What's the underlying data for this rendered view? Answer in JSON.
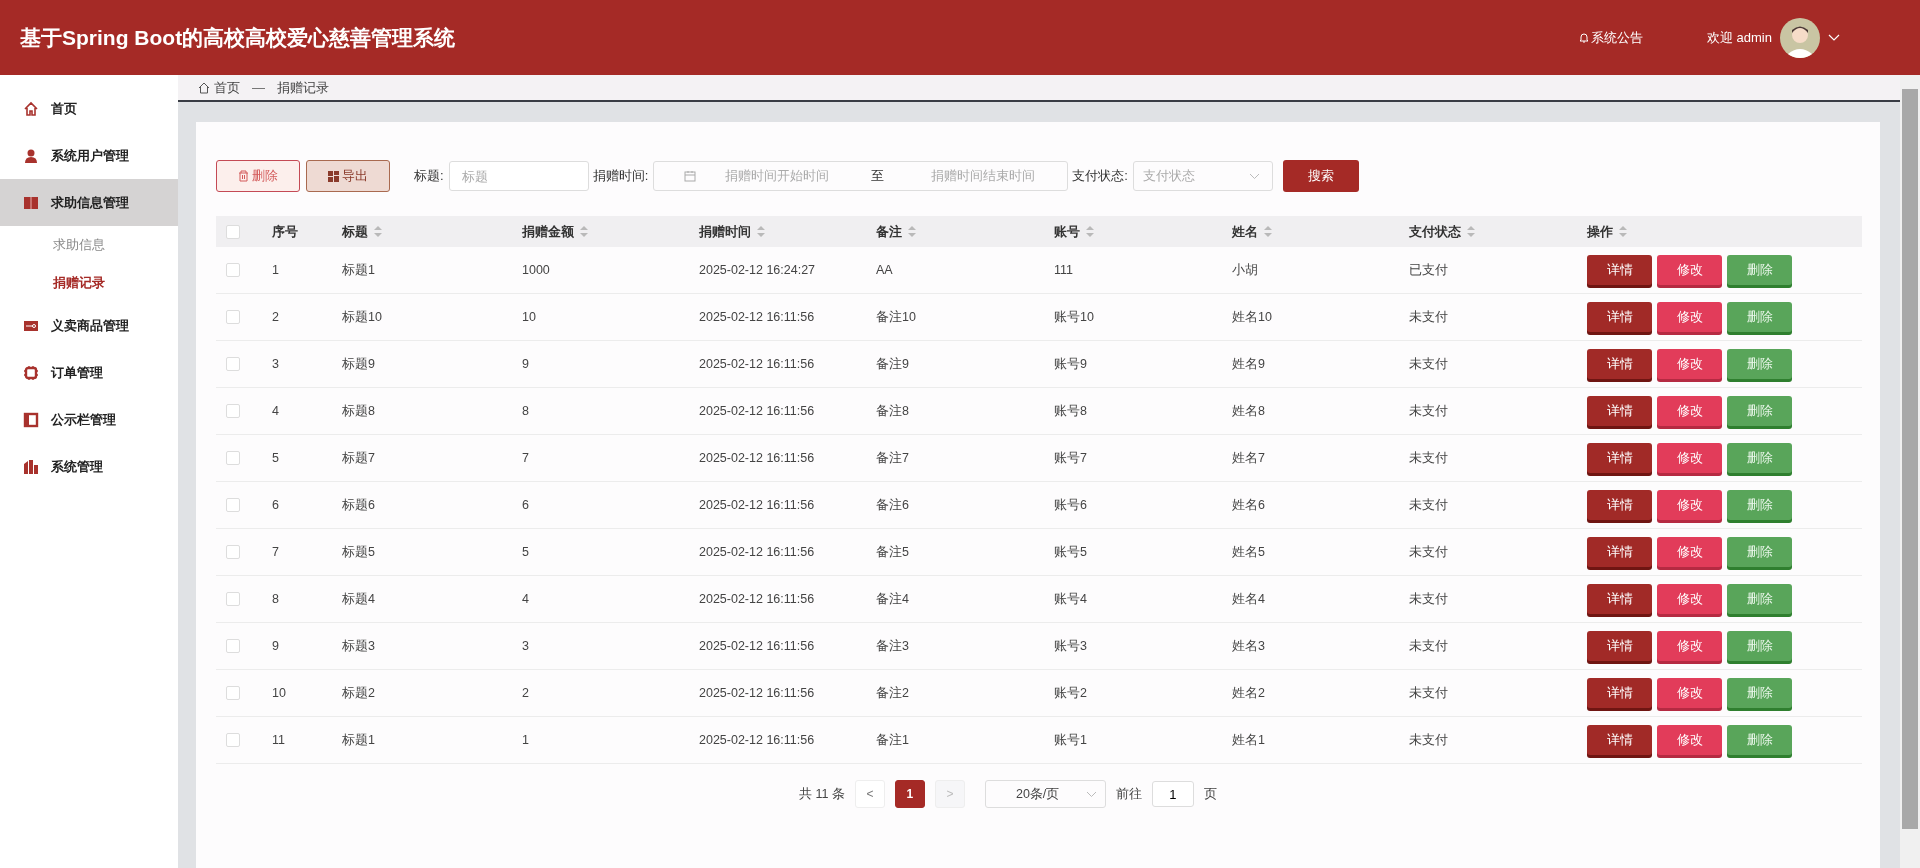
{
  "header": {
    "title": "基于Spring Boot的高校高校爱心慈善管理系统",
    "notice": "系统公告",
    "welcome": "欢迎 admin"
  },
  "sidebar": {
    "items": [
      {
        "label": "首页",
        "expanded": false
      },
      {
        "label": "系统用户管理",
        "expanded": false
      },
      {
        "label": "求助信息管理",
        "expanded": true,
        "children": [
          {
            "label": "求助信息",
            "selected": false
          },
          {
            "label": "捐赠记录",
            "selected": true
          }
        ]
      },
      {
        "label": "义卖商品管理",
        "expanded": false
      },
      {
        "label": "订单管理",
        "expanded": false
      },
      {
        "label": "公示栏管理",
        "expanded": false
      },
      {
        "label": "系统管理",
        "expanded": false
      }
    ]
  },
  "breadcrumb": {
    "items": [
      "首页",
      "捐赠记录"
    ],
    "separator": "—"
  },
  "toolbar": {
    "delete": "删除",
    "export": "导出",
    "title_label": "标题:",
    "title_placeholder": "标题",
    "time_label": "捐赠时间:",
    "start_placeholder": "捐赠时间开始时间",
    "range_sep": "至",
    "end_placeholder": "捐赠时间结束时间",
    "status_label": "支付状态:",
    "status_placeholder": "支付状态",
    "search": "搜索"
  },
  "table": {
    "header_checked": false,
    "columns": [
      "序号",
      "标题",
      "捐赠金额",
      "捐赠时间",
      "备注",
      "账号",
      "姓名",
      "支付状态",
      "操作"
    ],
    "rows": [
      {
        "checked": false,
        "cells": [
          "1",
          "标题1",
          "1000",
          "2025-02-12 16:24:27",
          "AA",
          "111",
          "小胡",
          "已支付"
        ],
        "actions": [
          "详情",
          "修改",
          "删除"
        ]
      },
      {
        "checked": false,
        "cells": [
          "2",
          "标题10",
          "10",
          "2025-02-12 16:11:56",
          "备注10",
          "账号10",
          "姓名10",
          "未支付"
        ],
        "actions": [
          "详情",
          "修改",
          "删除"
        ]
      },
      {
        "checked": false,
        "cells": [
          "3",
          "标题9",
          "9",
          "2025-02-12 16:11:56",
          "备注9",
          "账号9",
          "姓名9",
          "未支付"
        ],
        "actions": [
          "详情",
          "修改",
          "删除"
        ]
      },
      {
        "checked": false,
        "cells": [
          "4",
          "标题8",
          "8",
          "2025-02-12 16:11:56",
          "备注8",
          "账号8",
          "姓名8",
          "未支付"
        ],
        "actions": [
          "详情",
          "修改",
          "删除"
        ]
      },
      {
        "checked": false,
        "cells": [
          "5",
          "标题7",
          "7",
          "2025-02-12 16:11:56",
          "备注7",
          "账号7",
          "姓名7",
          "未支付"
        ],
        "actions": [
          "详情",
          "修改",
          "删除"
        ]
      },
      {
        "checked": false,
        "cells": [
          "6",
          "标题6",
          "6",
          "2025-02-12 16:11:56",
          "备注6",
          "账号6",
          "姓名6",
          "未支付"
        ],
        "actions": [
          "详情",
          "修改",
          "删除"
        ]
      },
      {
        "checked": false,
        "cells": [
          "7",
          "标题5",
          "5",
          "2025-02-12 16:11:56",
          "备注5",
          "账号5",
          "姓名5",
          "未支付"
        ],
        "actions": [
          "详情",
          "修改",
          "删除"
        ]
      },
      {
        "checked": false,
        "cells": [
          "8",
          "标题4",
          "4",
          "2025-02-12 16:11:56",
          "备注4",
          "账号4",
          "姓名4",
          "未支付"
        ],
        "actions": [
          "详情",
          "修改",
          "删除"
        ]
      },
      {
        "checked": false,
        "cells": [
          "9",
          "标题3",
          "3",
          "2025-02-12 16:11:56",
          "备注3",
          "账号3",
          "姓名3",
          "未支付"
        ],
        "actions": [
          "详情",
          "修改",
          "删除"
        ]
      },
      {
        "checked": false,
        "cells": [
          "10",
          "标题2",
          "2",
          "2025-02-12 16:11:56",
          "备注2",
          "账号2",
          "姓名2",
          "未支付"
        ],
        "actions": [
          "详情",
          "修改",
          "删除"
        ]
      },
      {
        "checked": false,
        "cells": [
          "11",
          "标题1",
          "1",
          "2025-02-12 16:11:56",
          "备注1",
          "账号1",
          "姓名1",
          "未支付"
        ],
        "actions": [
          "详情",
          "修改",
          "删除"
        ]
      }
    ]
  },
  "pagination": {
    "total": "共 11 条",
    "prev": "<",
    "pages": [
      {
        "label": "1",
        "selected": true
      }
    ],
    "next": ">",
    "page_size": "20条/页",
    "goto_label": "前往",
    "goto_value": "1",
    "page_unit": "页"
  }
}
